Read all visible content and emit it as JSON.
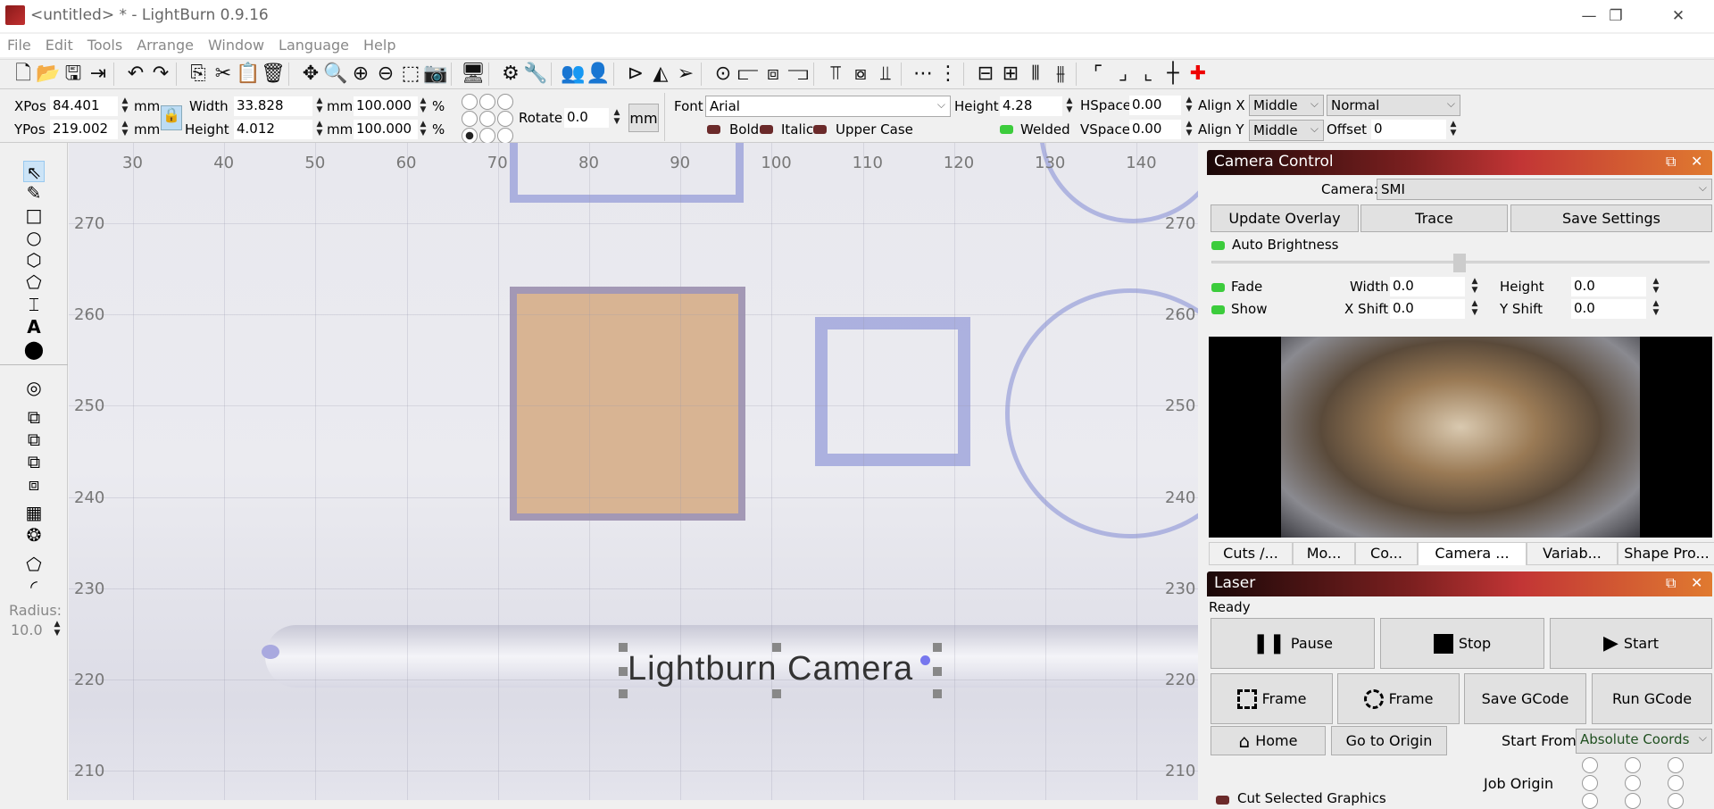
{
  "window": {
    "title": "<untitled> * - LightBurn 0.9.16",
    "minimize": "—",
    "restore": "❐",
    "close": "✕"
  },
  "menu": [
    "File",
    "Edit",
    "Tools",
    "Arrange",
    "Window",
    "Language",
    "Help"
  ],
  "toolbar": [
    {
      "name": "new-file-icon",
      "g": "🗋"
    },
    {
      "name": "open-folder-icon",
      "g": "📂"
    },
    {
      "name": "save-icon",
      "g": "🖫"
    },
    {
      "name": "import-icon",
      "g": "⇥"
    },
    {
      "sep": true
    },
    {
      "name": "undo-icon",
      "g": "↶"
    },
    {
      "name": "redo-icon",
      "g": "↷"
    },
    {
      "sep": true
    },
    {
      "name": "copy-icon",
      "g": "⎘"
    },
    {
      "name": "cut-icon",
      "g": "✂"
    },
    {
      "name": "paste-icon",
      "g": "📋"
    },
    {
      "name": "delete-icon",
      "g": "🗑"
    },
    {
      "sep": true
    },
    {
      "name": "move-icon",
      "g": "✥"
    },
    {
      "name": "zoom-page-icon",
      "g": "🔍"
    },
    {
      "name": "zoom-in-icon",
      "g": "⊕"
    },
    {
      "name": "zoom-out-icon",
      "g": "⊖"
    },
    {
      "name": "zoom-selection-icon",
      "g": "⬚"
    },
    {
      "name": "camera-icon",
      "g": "📷"
    },
    {
      "sep": true
    },
    {
      "name": "monitor-icon",
      "g": "🖥"
    },
    {
      "sep": true
    },
    {
      "name": "settings-icon",
      "g": "⚙"
    },
    {
      "name": "tools-icon",
      "g": "🔧"
    },
    {
      "sep": true
    },
    {
      "name": "group-icon",
      "g": "👥"
    },
    {
      "name": "ungroup-icon",
      "g": "👤"
    },
    {
      "sep": true
    },
    {
      "name": "flip-horizontal-icon",
      "g": "⊳"
    },
    {
      "name": "mirror-icon",
      "g": "◭"
    },
    {
      "name": "send-icon",
      "g": "➢"
    },
    {
      "sep": true
    },
    {
      "name": "center-icon",
      "g": "⊙"
    },
    {
      "name": "align-left-icon",
      "g": "⫍"
    },
    {
      "name": "align-hcenter-icon",
      "g": "⧈"
    },
    {
      "name": "align-right-icon",
      "g": "⫎"
    },
    {
      "sep": true
    },
    {
      "name": "align-top-icon",
      "g": "⫪"
    },
    {
      "name": "align-vcenter-icon",
      "g": "⧇"
    },
    {
      "name": "align-bottom-icon",
      "g": "⫫"
    },
    {
      "sep": true
    },
    {
      "name": "distribute-h-icon",
      "g": "⋯"
    },
    {
      "name": "distribute-v-icon",
      "g": "⋮"
    },
    {
      "sep": true
    },
    {
      "name": "move-together-icon",
      "g": "⊟"
    },
    {
      "name": "stack-icon",
      "g": "⊞"
    },
    {
      "name": "spread-icon",
      "g": "⫴"
    },
    {
      "name": "dock-icon",
      "g": "⫵"
    },
    {
      "sep": true
    },
    {
      "name": "corner-tl-icon",
      "g": "⌜"
    },
    {
      "name": "corner-br-icon",
      "g": "⌟"
    },
    {
      "name": "origin-bl-icon",
      "g": "⌞"
    },
    {
      "name": "crosshair-icon",
      "g": "┼"
    },
    {
      "name": "laser-position-icon",
      "g": "✚"
    }
  ],
  "props": {
    "xpos_label": "XPos",
    "xpos": "84.401",
    "ypos_label": "YPos",
    "ypos": "219.002",
    "unit": "mm",
    "width_label": "Width",
    "width": "33.828",
    "height_label": "Height",
    "height": "4.012",
    "scale_w": "100.000",
    "scale_h": "100.000",
    "pct": "%",
    "rotate_label": "Rotate",
    "rotate": "0.0",
    "mm_button": "mm"
  },
  "text": {
    "font_label": "Font",
    "font": "Arial",
    "height_label": "Height",
    "height": "4.28",
    "hspace_label": "HSpace",
    "hspace": "0.00",
    "vspace_label": "VSpace",
    "vspace": "0.00",
    "alignx_label": "Align X",
    "alignx": "Middle",
    "aligny_label": "Align Y",
    "aligny": "Middle",
    "mode": "Normal",
    "offset_label": "Offset",
    "offset": "0",
    "bold": "Bold",
    "italic": "Italic",
    "upper": "Upper Case",
    "welded": "Welded"
  },
  "lefttools": {
    "radius_label": "Radius:",
    "radius": "10.0"
  },
  "canvas": {
    "xticks": [
      "30",
      "40",
      "50",
      "60",
      "70",
      "80",
      "90",
      "100",
      "110",
      "120",
      "130",
      "140"
    ],
    "yticks": [
      "270",
      "260",
      "250",
      "240",
      "230",
      "220",
      "210"
    ],
    "text_object": "Lightburn Camera"
  },
  "camera": {
    "title": "Camera Control",
    "camera_label": "Camera:",
    "camera": "SMI",
    "update_overlay": "Update Overlay",
    "trace": "Trace",
    "save_settings": "Save Settings",
    "auto_brightness": "Auto Brightness",
    "brightness": 0.5,
    "fade": "Fade",
    "show": "Show",
    "width_label": "Width",
    "width": "0.0",
    "height_label": "Height",
    "height": "0.0",
    "xshift_label": "X Shift",
    "xshift": "0.0",
    "yshift_label": "Y Shift",
    "yshift": "0.0"
  },
  "tabs": [
    "Cuts /...",
    "Mo...",
    "Co...",
    "Camera ...",
    "Variab...",
    "Shape Pro..."
  ],
  "laser": {
    "title": "Laser",
    "status": "Ready",
    "pause": "Pause",
    "stop": "Stop",
    "start": "Start",
    "frame1": "Frame",
    "frame2": "Frame",
    "save_gcode": "Save GCode",
    "run_gcode": "Run GCode",
    "home": "Home",
    "go_origin": "Go to Origin",
    "start_from_label": "Start From:",
    "start_from": "Absolute Coords",
    "job_origin": "Job Origin",
    "cut_selected": "Cut Selected Graphics"
  }
}
